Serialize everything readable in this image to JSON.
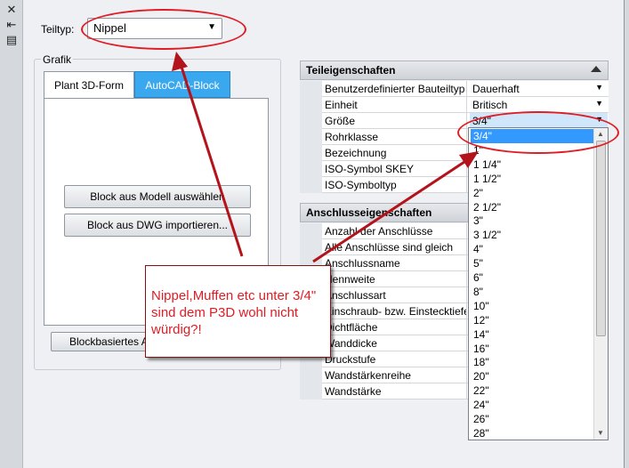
{
  "toolbar": {
    "close_icon": "close-icon",
    "pin_icon": "autohide-icon",
    "props_icon": "properties-icon"
  },
  "teiltyp": {
    "label": "Teiltyp:",
    "value": "Nippel"
  },
  "grafik": {
    "label": "Grafik",
    "tabs": [
      {
        "label": "Plant 3D-Form"
      },
      {
        "label": "AutoCAD-Block"
      }
    ],
    "btn_block_modell": "Block aus Modell auswählen",
    "btn_block_dwg": "Block aus DWG importieren...",
    "btn_blockbasiert": "Blockbasiertes A"
  },
  "teileigenschaften": {
    "header": "Teileigenschaften",
    "rows": [
      {
        "name": "Benutzerdefinierter Bauteiltyp",
        "value": "Dauerhaft"
      },
      {
        "name": "Einheit",
        "value": "Britisch"
      },
      {
        "name": "Größe",
        "value": "3/4\""
      },
      {
        "name": "Rohrklasse",
        "value": ""
      },
      {
        "name": "Bezeichnung",
        "value": ""
      },
      {
        "name": "ISO-Symbol SKEY",
        "value": ""
      },
      {
        "name": "ISO-Symboltyp",
        "value": ""
      }
    ]
  },
  "anschlusseigenschaften": {
    "header": "Anschlusseigenschaften",
    "rows": [
      {
        "name": "Anzahl der Anschlüsse"
      },
      {
        "name": "Alle Anschlüsse sind gleich"
      },
      {
        "name": "Anschlussname"
      },
      {
        "name": "Nennweite"
      },
      {
        "name": "Anschlussart"
      },
      {
        "name": "Einschraub- bzw. Einstecktiefe"
      },
      {
        "name": "Dichtfläche"
      },
      {
        "name": "Wanddicke"
      },
      {
        "name": "Druckstufe"
      },
      {
        "name": "Wandstärkenreihe"
      },
      {
        "name": "Wandstärke"
      }
    ]
  },
  "size_dropdown": {
    "items": [
      "3/4\"",
      "1\"",
      "1 1/4\"",
      "1 1/2\"",
      "2\"",
      "2 1/2\"",
      "3\"",
      "3 1/2\"",
      "4\"",
      "5\"",
      "6\"",
      "8\"",
      "10\"",
      "12\"",
      "14\"",
      "16\"",
      "18\"",
      "20\"",
      "22\"",
      "24\"",
      "26\"",
      "28\""
    ],
    "selected": "3/4\""
  },
  "annotation": {
    "text": "Nippel,Muffen etc unter 3/4\" sind dem P3D wohl nicht würdig?!",
    "color": "#e01c24"
  }
}
